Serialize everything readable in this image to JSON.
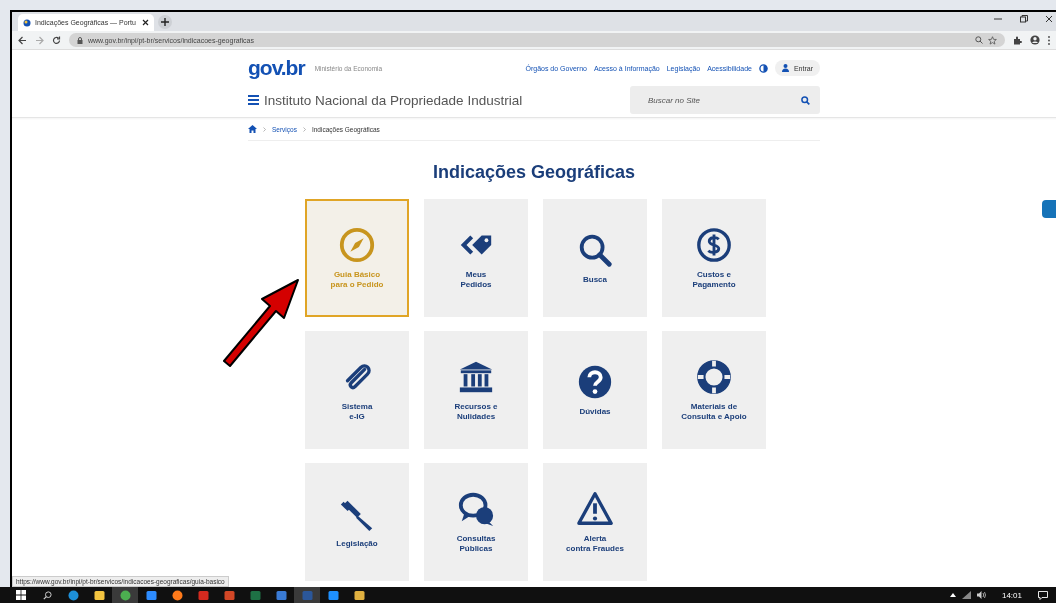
{
  "browser": {
    "tab_title": "Indicações Geográficas — Portu",
    "address": "www.gov.br/inpi/pt-br/servicos/indicacoes-geograficas",
    "status_url": "https://www.gov.br/inpi/pt-br/servicos/indicacoes-geograficas/guia-basico"
  },
  "header": {
    "logo": "gov.br",
    "ministry": "Ministério da Economia",
    "links": [
      "Órgãos do Governo",
      "Acesso à Informação",
      "Legislação",
      "Acessibilidade"
    ],
    "login": "Entrar",
    "site_title": "Instituto Nacional da Propriedade Industrial",
    "search": {
      "placeholder": "Buscar no Site"
    }
  },
  "breadcrumb": [
    {
      "label": "Serviços",
      "current": false
    },
    {
      "label": "Indicações Geográficas",
      "current": true
    }
  ],
  "heading": "Indicações Geográficas",
  "tiles": [
    {
      "kind": "compass",
      "label": "Guia Básico\npara o Pedido",
      "selected": true
    },
    {
      "kind": "tag",
      "label": "Meus\nPedidos",
      "selected": false
    },
    {
      "kind": "search",
      "label": "Busca",
      "selected": false
    },
    {
      "kind": "dollar",
      "label": "Custos e\nPagamento",
      "selected": false
    },
    {
      "kind": "paperclip",
      "label": "Sistema\ne-IG",
      "selected": false
    },
    {
      "kind": "building",
      "label": "Recursos e\nNulidades",
      "selected": false
    },
    {
      "kind": "question",
      "label": "Dúvidas",
      "selected": false
    },
    {
      "kind": "lifebuoy",
      "label": "Materiais de\nConsulta e Apoio",
      "selected": false
    },
    {
      "kind": "gavel",
      "label": "Legislação",
      "selected": false
    },
    {
      "kind": "chat",
      "label": "Consultas\nPúblicas",
      "selected": false
    },
    {
      "kind": "warning",
      "label": "Alerta\ncontra Fraudes",
      "selected": false
    }
  ],
  "taskbar": {
    "apps": [
      {
        "kind": "blue",
        "selected": false
      },
      {
        "kind": "folder",
        "selected": false
      },
      {
        "kind": "round",
        "selected": true
      },
      {
        "kind": "camera",
        "selected": false
      },
      {
        "kind": "orange",
        "selected": false
      },
      {
        "kind": "red",
        "selected": false
      },
      {
        "kind": "slides",
        "selected": false
      },
      {
        "kind": "sheet",
        "selected": false
      },
      {
        "kind": "window",
        "selected": false
      },
      {
        "kind": "doc",
        "selected": true
      },
      {
        "kind": "chatapp",
        "selected": false
      },
      {
        "kind": "files",
        "selected": false
      }
    ],
    "time": "14:01"
  }
}
